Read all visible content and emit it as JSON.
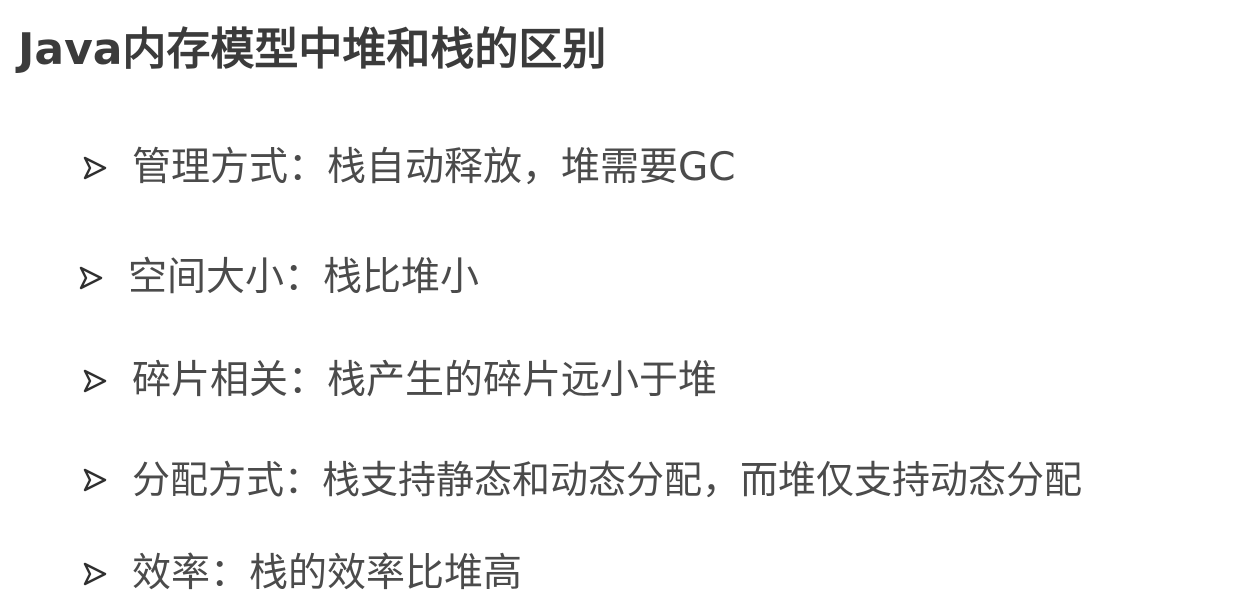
{
  "slide": {
    "title": "Java内存模型中堆和栈的区别",
    "bullets": [
      {
        "icon": "arrowhead-bullet-icon",
        "text": "管理方式：栈自动释放，堆需要GC"
      },
      {
        "icon": "arrowhead-bullet-icon",
        "text": "空间大小：栈比堆小"
      },
      {
        "icon": "arrowhead-bullet-icon",
        "text": "碎片相关：栈产生的碎片远小于堆"
      },
      {
        "icon": "arrowhead-bullet-icon",
        "text": "分配方式：栈支持静态和动态分配，而堆仅支持动态分配"
      },
      {
        "icon": "arrowhead-bullet-icon",
        "text": "效率：栈的效率比堆高"
      }
    ]
  },
  "colors": {
    "background": "#ffffff",
    "title": "#3b3b3b",
    "text": "#4b4b4b",
    "bullet": "#2f2f2f"
  }
}
